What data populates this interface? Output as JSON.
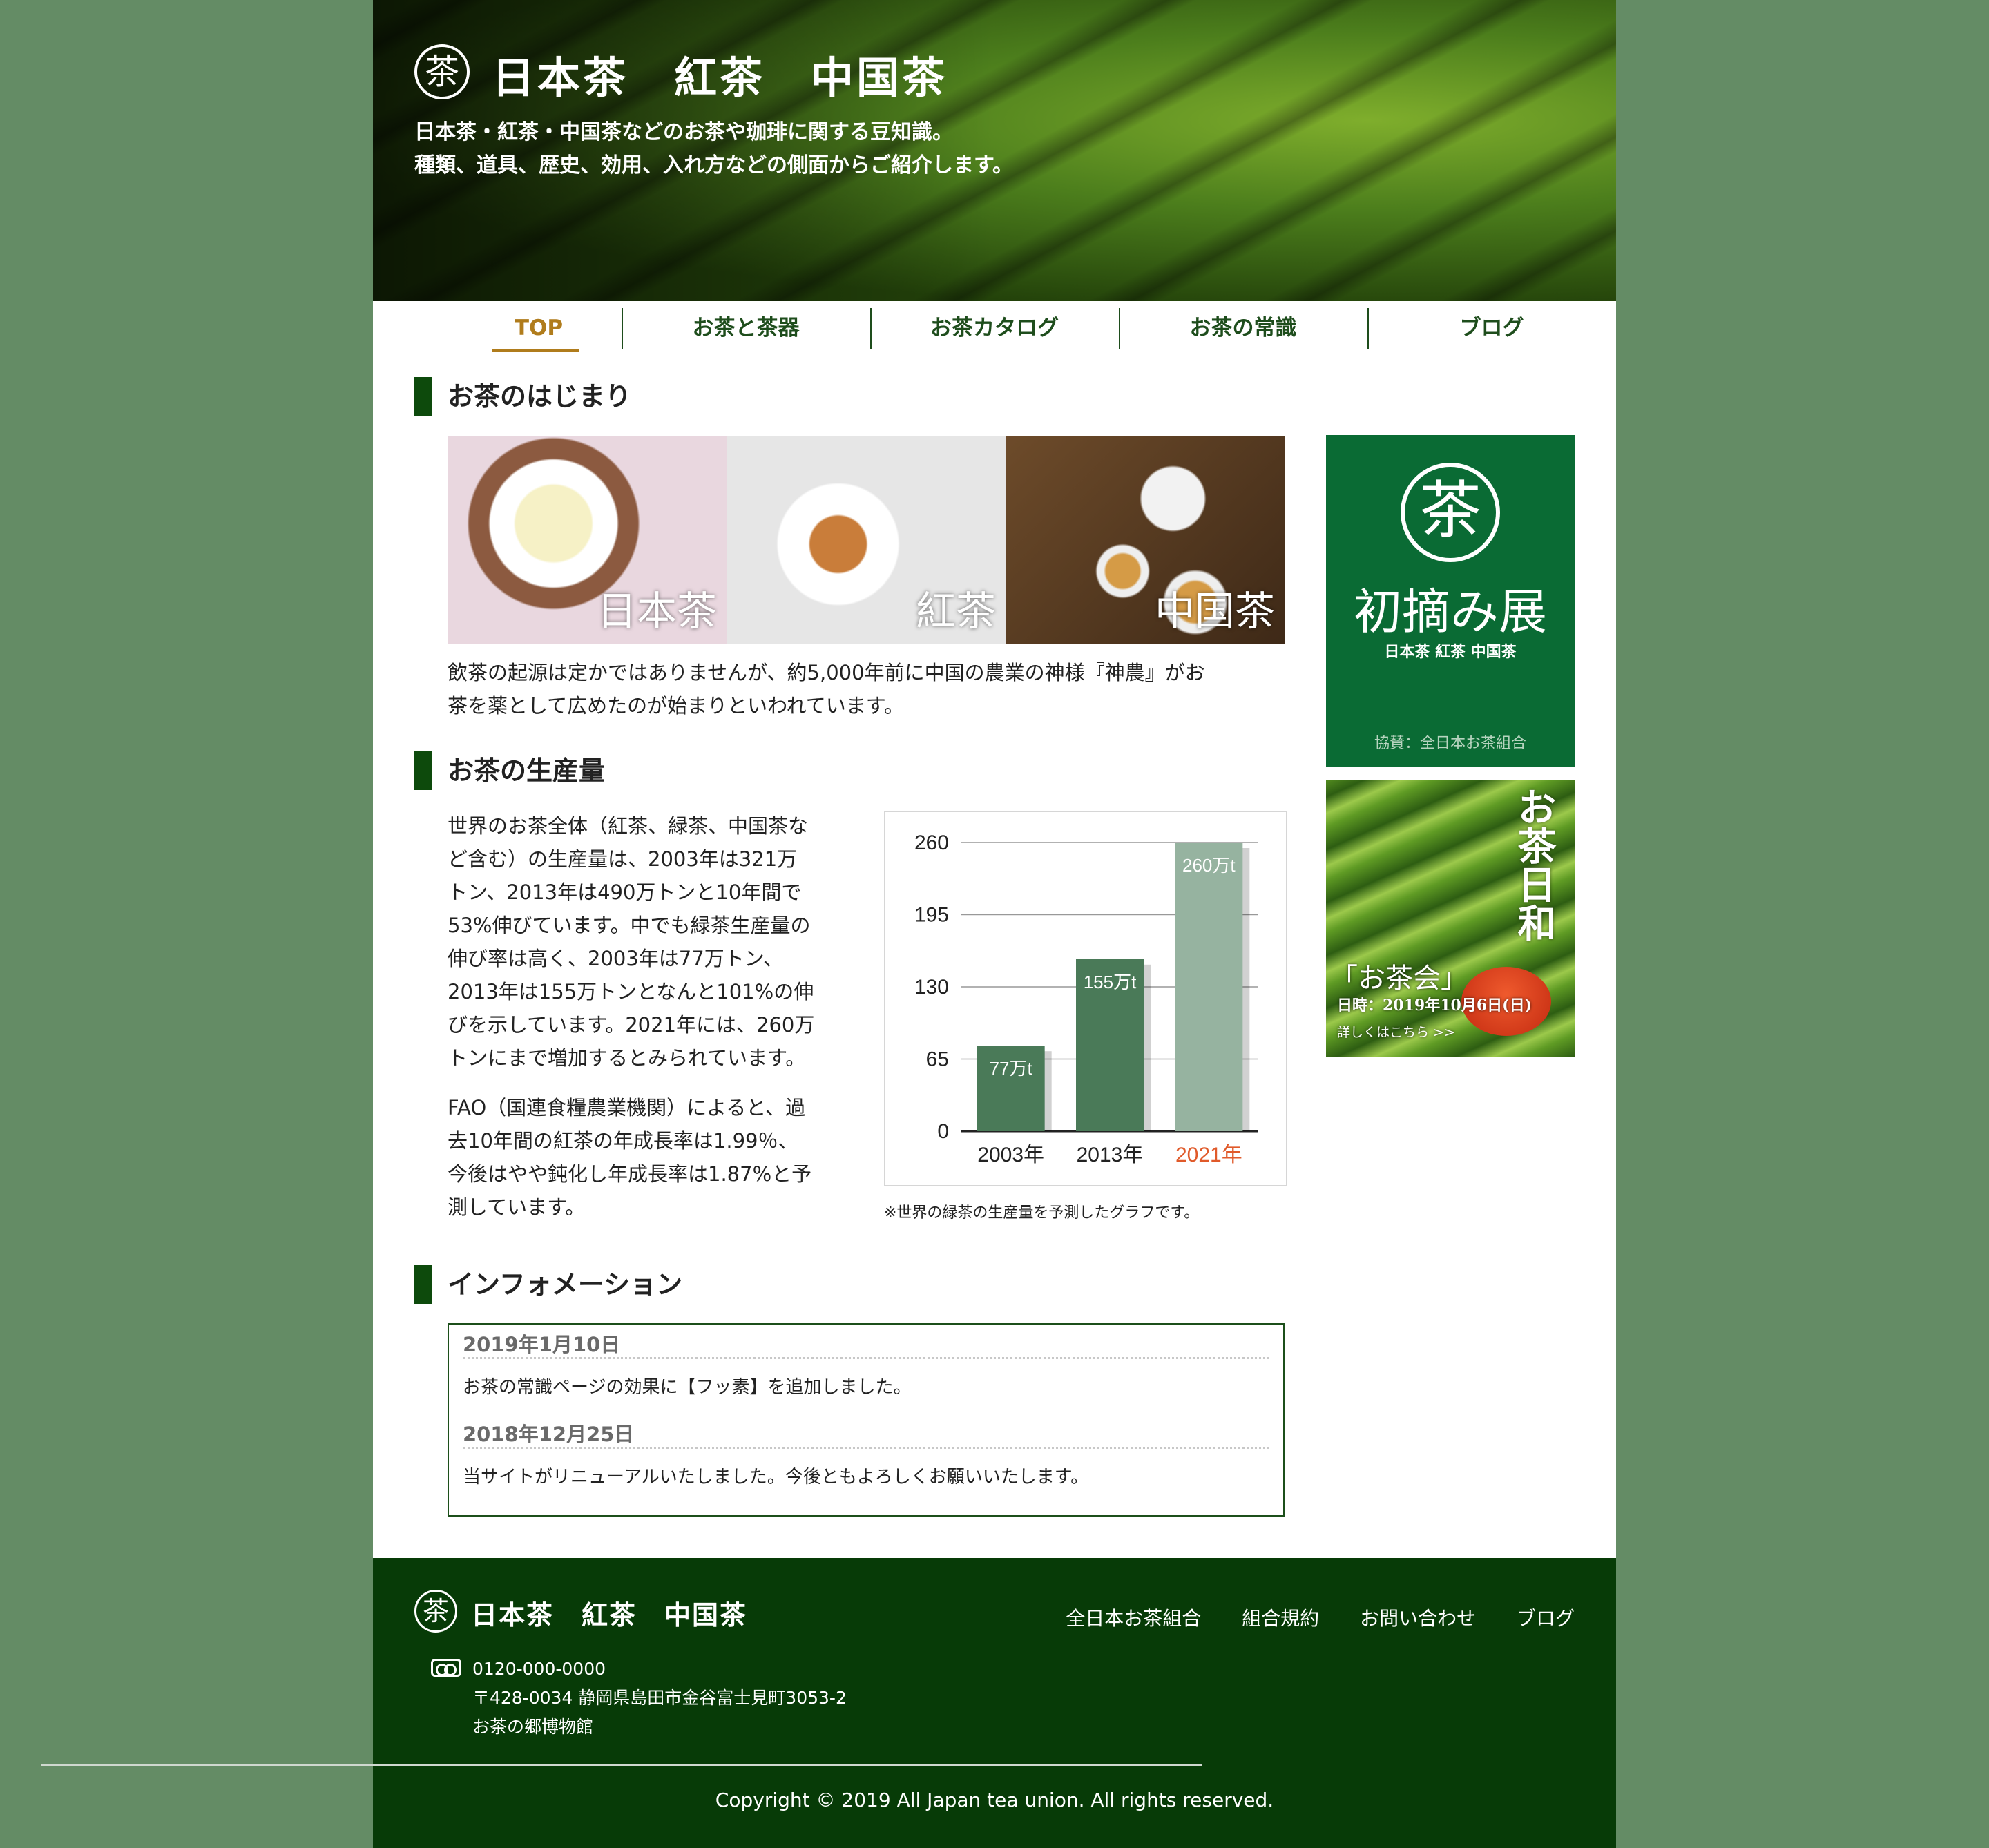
{
  "header": {
    "logo_glyph": "茶",
    "title": "日本茶　紅茶　中国茶",
    "tagline_line1": "日本茶・紅茶・中国茶などのお茶や珈琲に関する豆知識。",
    "tagline_line2": "種類、道具、歴史、効用、入れ方などの側面からご紹介します。"
  },
  "nav": {
    "items": [
      {
        "label": "TOP",
        "active": true
      },
      {
        "label": "お茶と茶器"
      },
      {
        "label": "お茶カタログ"
      },
      {
        "label": "お茶の常識"
      },
      {
        "label": "ブログ"
      }
    ],
    "active_color": "#b07c1c"
  },
  "section_origin": {
    "heading": "お茶のはじまり",
    "photos": [
      {
        "caption": "日本茶"
      },
      {
        "caption": "紅茶"
      },
      {
        "caption": "中国茶"
      }
    ],
    "text_line1": "飲茶の起源は定かではありませんが、約5,000年前に中国の農業の神様『神農』がお",
    "text_line2": "茶を薬として広めたのが始まりといわれています。"
  },
  "section_production": {
    "heading": "お茶の生産量",
    "para1_lines": [
      "世界のお茶全体（紅茶、緑茶、中国茶な",
      "ど含む）の生産量は、2003年は321万",
      "トン、2013年は490万トンと10年間で",
      "53%伸びています。中でも緑茶生産量の",
      "伸び率は高く、2003年は77万トン、",
      "2013年は155万トンとなんと101%の伸",
      "びを示しています。2021年には、260万",
      "トンにまで増加するとみられています。"
    ],
    "para2_lines": [
      "FAO（国連食糧農業機関）によると、過",
      "去10年間の紅茶の年成長率は1.99％、",
      "今後はやや鈍化し年成長率は1.87%と予",
      "測しています。"
    ],
    "chart_note": "※世界の緑茶の生産量を予測したグラフです。"
  },
  "chart_data": {
    "type": "bar",
    "categories": [
      "2003年",
      "2013年",
      "2021年"
    ],
    "values": [
      77,
      155,
      260
    ],
    "data_labels": [
      "77万t",
      "155万t",
      "260万t"
    ],
    "yticks": [
      0,
      65,
      130,
      195,
      260
    ],
    "ylim": [
      0,
      260
    ],
    "bar_colors": [
      "#4a7a58",
      "#4a7a58",
      "#96b3a0"
    ],
    "highlight_label_color": "#e05a2a",
    "grid": true
  },
  "section_info": {
    "heading": "インフォメーション",
    "items": [
      {
        "date": "2019年1月10日",
        "text": "お茶の常識ページの効果に【フッ素】を追加しました。"
      },
      {
        "date": "2018年12月25日",
        "text": "当サイトがリニューアルいたしました。今後ともよろしくお願いいたします。"
      }
    ]
  },
  "sidebar": {
    "banner1": {
      "glyph": "茶",
      "title": "初摘み展",
      "subtitle": "日本茶 紅茶 中国茶",
      "footer": "協賛：全日本お茶組合"
    },
    "banner2": {
      "title": "お茶日和",
      "event": "「お茶会」",
      "date": "日時：2019年10月6日(日)",
      "more": "詳しくはこちら >>"
    }
  },
  "footer": {
    "glyph": "茶",
    "title": "日本茶　紅茶　中国茶",
    "links": [
      "全日本お茶組合",
      "組合規約",
      "お問い合わせ",
      "ブログ"
    ],
    "phone": "0120-000-0000",
    "address": "〒428-0034 静岡県島田市金谷富士見町3053-2",
    "place": "お茶の郷博物館",
    "copyright": "Copyright © 2019 All Japan tea union. All rights reserved."
  }
}
